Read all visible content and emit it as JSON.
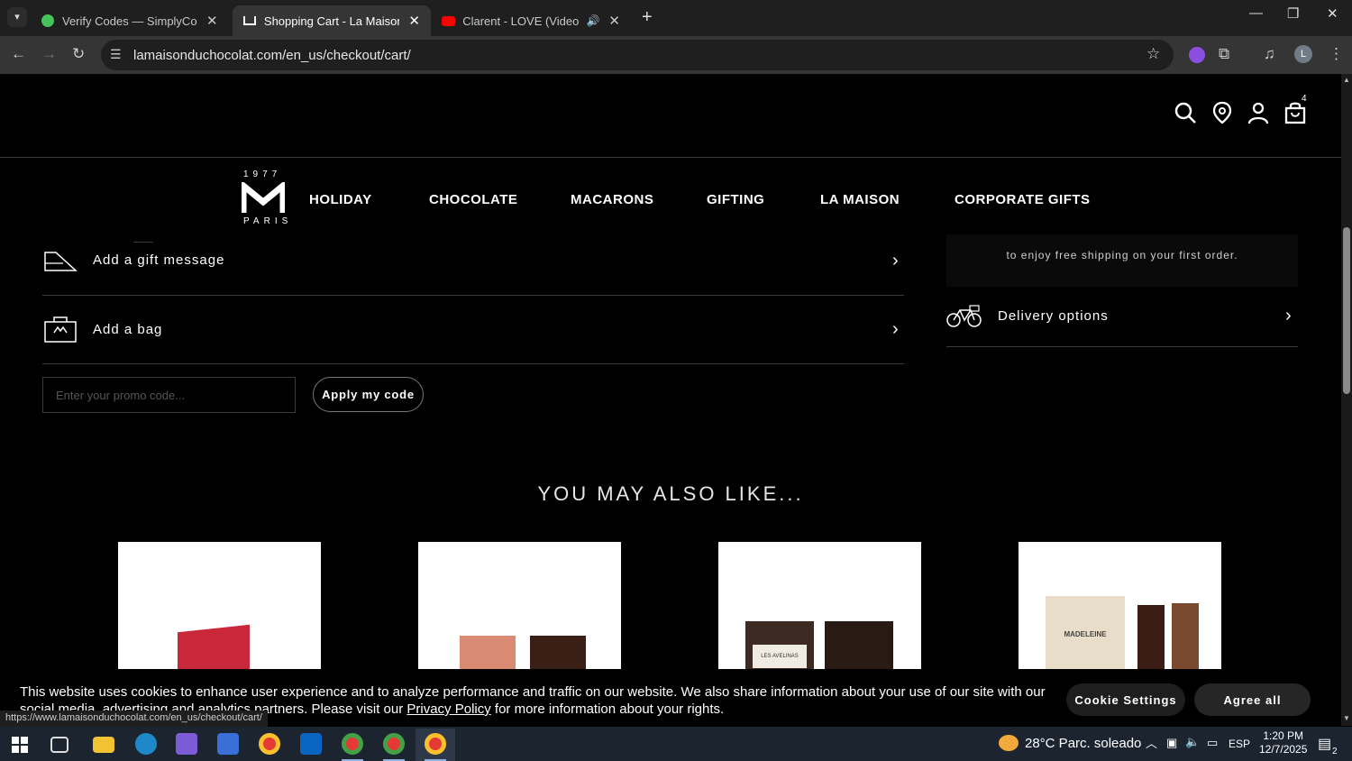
{
  "browser": {
    "tabs": [
      {
        "title": "Verify Codes — SimplyCodes",
        "active": false
      },
      {
        "title": "Shopping Cart - La Maison Du Chocolat",
        "active": true
      },
      {
        "title": "Clarent - LOVE (Video Oficial)",
        "active": false,
        "audio": true
      }
    ],
    "url": "lamaisonduchocolat.com/en_us/checkout/cart/",
    "status_url": "https://www.lamaisonduchocolat.com/en_us/checkout/cart/",
    "profile_initial": "L"
  },
  "site": {
    "cart_count": "4",
    "logo": {
      "year": "1977",
      "city": "PARIS"
    },
    "nav": [
      "HOLIDAY",
      "CHOCOLATE",
      "MACARONS",
      "GIFTING",
      "LA MAISON",
      "CORPORATE GIFTS"
    ]
  },
  "cart": {
    "gift_message_label": "Add a gift message",
    "bag_label": "Add a bag",
    "promo_placeholder": "Enter your promo code...",
    "apply_label": "Apply my code",
    "shipping_note": "to enjoy free shipping on your first order.",
    "delivery_label": "Delivery options"
  },
  "recommendations": {
    "title": "YOU MAY ALSO LIKE...",
    "products": [
      {
        "box_text": ""
      },
      {
        "box_text": ""
      },
      {
        "box_text": "LES AVELINAS"
      },
      {
        "box_text": "MADELEINE"
      }
    ]
  },
  "cookie": {
    "text_before": "This website uses cookies to enhance user experience and to analyze performance and traffic on our website. We also share information about your use of our site with our social media, advertising and analytics partners. Please visit our ",
    "link": "Privacy Policy",
    "text_after": " for more information about your rights.",
    "settings_label": "Cookie Settings",
    "agree_label": "Agree all"
  },
  "taskbar": {
    "weather": "28°C  Parc. soleado",
    "lang": "ESP",
    "time": "1:20 PM",
    "date": "12/7/2025",
    "notifications": "2"
  }
}
